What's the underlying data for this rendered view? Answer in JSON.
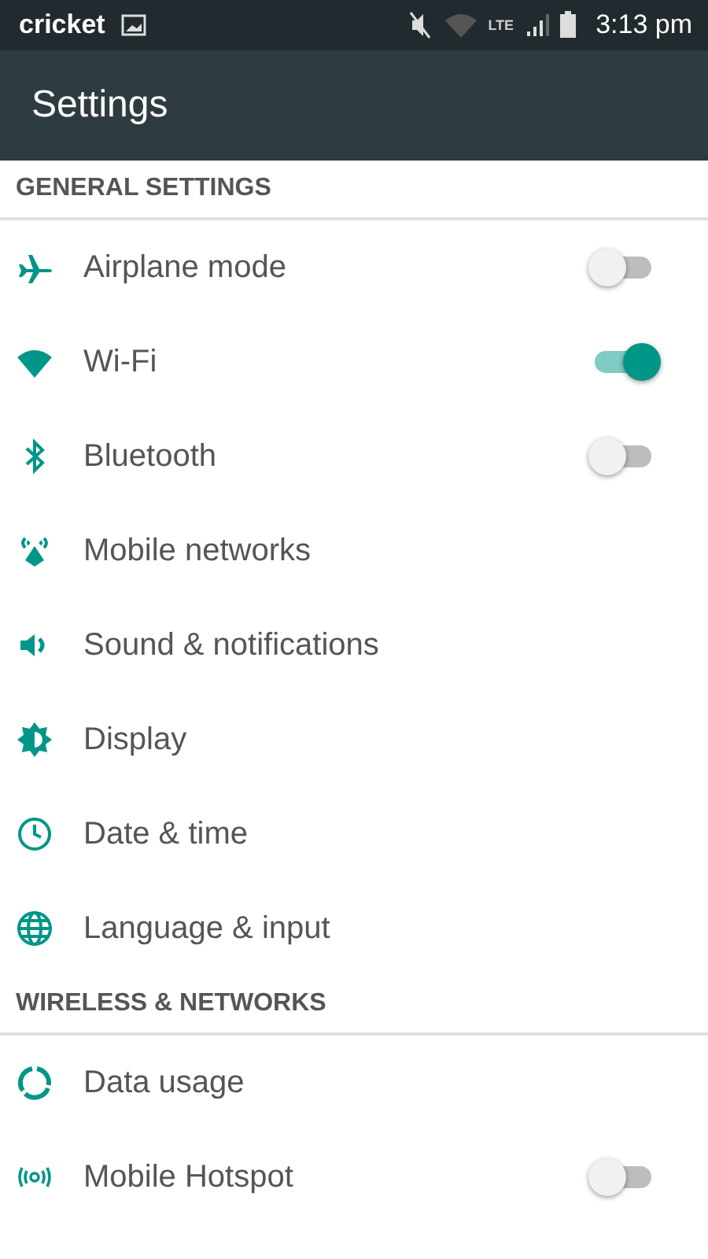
{
  "status_bar": {
    "carrier": "cricket",
    "network": "LTE",
    "time": "3:13 pm"
  },
  "app_bar": {
    "title": "Settings"
  },
  "sections": [
    {
      "title": "GENERAL SETTINGS",
      "items": [
        {
          "label": "Airplane mode",
          "kind": "toggle",
          "on": false
        },
        {
          "label": "Wi-Fi",
          "kind": "toggle",
          "on": true
        },
        {
          "label": "Bluetooth",
          "kind": "toggle",
          "on": false
        },
        {
          "label": "Mobile networks",
          "kind": "link"
        },
        {
          "label": "Sound & notifications",
          "kind": "link"
        },
        {
          "label": "Display",
          "kind": "link"
        },
        {
          "label": "Date & time",
          "kind": "link"
        },
        {
          "label": "Language & input",
          "kind": "link"
        }
      ]
    },
    {
      "title": "WIRELESS & NETWORKS",
      "items": [
        {
          "label": "Data usage",
          "kind": "link"
        },
        {
          "label": "Mobile Hotspot",
          "kind": "toggle",
          "on": false
        }
      ]
    }
  ]
}
